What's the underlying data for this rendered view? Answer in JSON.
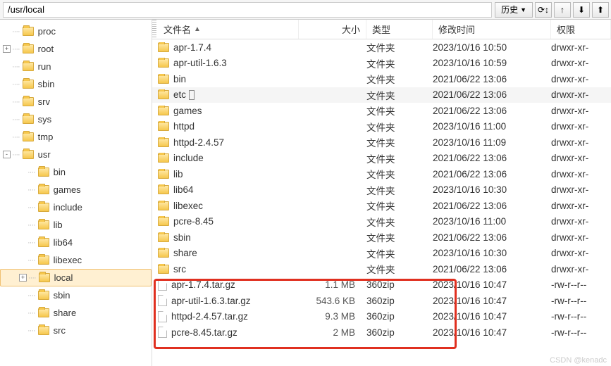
{
  "toolbar": {
    "path": "/usr/local",
    "history": "历史",
    "icons": {
      "refresh": "⟳↕",
      "reconnect": "↑",
      "download": "⬇",
      "upload": "⬆"
    }
  },
  "columns": {
    "name": "文件名",
    "size": "大小",
    "type": "类型",
    "date": "修改时间",
    "perm": "权限"
  },
  "tree": [
    {
      "label": "proc",
      "depth": 1,
      "toggle": ""
    },
    {
      "label": "root",
      "depth": 1,
      "toggle": "+"
    },
    {
      "label": "run",
      "depth": 1,
      "toggle": ""
    },
    {
      "label": "sbin",
      "depth": 1,
      "toggle": ""
    },
    {
      "label": "srv",
      "depth": 1,
      "toggle": ""
    },
    {
      "label": "sys",
      "depth": 1,
      "toggle": ""
    },
    {
      "label": "tmp",
      "depth": 1,
      "toggle": ""
    },
    {
      "label": "usr",
      "depth": 1,
      "toggle": "-"
    },
    {
      "label": "bin",
      "depth": 2,
      "toggle": ""
    },
    {
      "label": "games",
      "depth": 2,
      "toggle": ""
    },
    {
      "label": "include",
      "depth": 2,
      "toggle": ""
    },
    {
      "label": "lib",
      "depth": 2,
      "toggle": ""
    },
    {
      "label": "lib64",
      "depth": 2,
      "toggle": ""
    },
    {
      "label": "libexec",
      "depth": 2,
      "toggle": ""
    },
    {
      "label": "local",
      "depth": 2,
      "toggle": "+",
      "selected": true
    },
    {
      "label": "sbin",
      "depth": 2,
      "toggle": ""
    },
    {
      "label": "share",
      "depth": 2,
      "toggle": ""
    },
    {
      "label": "src",
      "depth": 2,
      "toggle": ""
    }
  ],
  "files": [
    {
      "name": "apr-1.7.4",
      "size": "",
      "type": "文件夹",
      "date": "2023/10/16 10:50",
      "perm": "drwxr-xr-",
      "kind": "folder"
    },
    {
      "name": "apr-util-1.6.3",
      "size": "",
      "type": "文件夹",
      "date": "2023/10/16 10:59",
      "perm": "drwxr-xr-",
      "kind": "folder"
    },
    {
      "name": "bin",
      "size": "",
      "type": "文件夹",
      "date": "2021/06/22 13:06",
      "perm": "drwxr-xr-",
      "kind": "folder"
    },
    {
      "name": "etc",
      "size": "",
      "type": "文件夹",
      "date": "2021/06/22 13:06",
      "perm": "drwxr-xr-",
      "kind": "folder",
      "cursor": true
    },
    {
      "name": "games",
      "size": "",
      "type": "文件夹",
      "date": "2021/06/22 13:06",
      "perm": "drwxr-xr-",
      "kind": "folder"
    },
    {
      "name": "httpd",
      "size": "",
      "type": "文件夹",
      "date": "2023/10/16 11:00",
      "perm": "drwxr-xr-",
      "kind": "folder"
    },
    {
      "name": "httpd-2.4.57",
      "size": "",
      "type": "文件夹",
      "date": "2023/10/16 11:09",
      "perm": "drwxr-xr-",
      "kind": "folder"
    },
    {
      "name": "include",
      "size": "",
      "type": "文件夹",
      "date": "2021/06/22 13:06",
      "perm": "drwxr-xr-",
      "kind": "folder"
    },
    {
      "name": "lib",
      "size": "",
      "type": "文件夹",
      "date": "2021/06/22 13:06",
      "perm": "drwxr-xr-",
      "kind": "folder"
    },
    {
      "name": "lib64",
      "size": "",
      "type": "文件夹",
      "date": "2023/10/16 10:30",
      "perm": "drwxr-xr-",
      "kind": "folder"
    },
    {
      "name": "libexec",
      "size": "",
      "type": "文件夹",
      "date": "2021/06/22 13:06",
      "perm": "drwxr-xr-",
      "kind": "folder"
    },
    {
      "name": "pcre-8.45",
      "size": "",
      "type": "文件夹",
      "date": "2023/10/16 11:00",
      "perm": "drwxr-xr-",
      "kind": "folder"
    },
    {
      "name": "sbin",
      "size": "",
      "type": "文件夹",
      "date": "2021/06/22 13:06",
      "perm": "drwxr-xr-",
      "kind": "folder"
    },
    {
      "name": "share",
      "size": "",
      "type": "文件夹",
      "date": "2023/10/16 10:30",
      "perm": "drwxr-xr-",
      "kind": "folder"
    },
    {
      "name": "src",
      "size": "",
      "type": "文件夹",
      "date": "2021/06/22 13:06",
      "perm": "drwxr-xr-",
      "kind": "folder"
    },
    {
      "name": "apr-1.7.4.tar.gz",
      "size": "1.1 MB",
      "type": "360zip",
      "date": "2023/10/16 10:47",
      "perm": "-rw-r--r--",
      "kind": "file"
    },
    {
      "name": "apr-util-1.6.3.tar.gz",
      "size": "543.6 KB",
      "type": "360zip",
      "date": "2023/10/16 10:47",
      "perm": "-rw-r--r--",
      "kind": "file"
    },
    {
      "name": "httpd-2.4.57.tar.gz",
      "size": "9.3 MB",
      "type": "360zip",
      "date": "2023/10/16 10:47",
      "perm": "-rw-r--r--",
      "kind": "file"
    },
    {
      "name": "pcre-8.45.tar.gz",
      "size": "2 MB",
      "type": "360zip",
      "date": "2023/10/16 10:47",
      "perm": "-rw-r--r--",
      "kind": "file"
    }
  ],
  "watermark": "CSDN @kenadc"
}
